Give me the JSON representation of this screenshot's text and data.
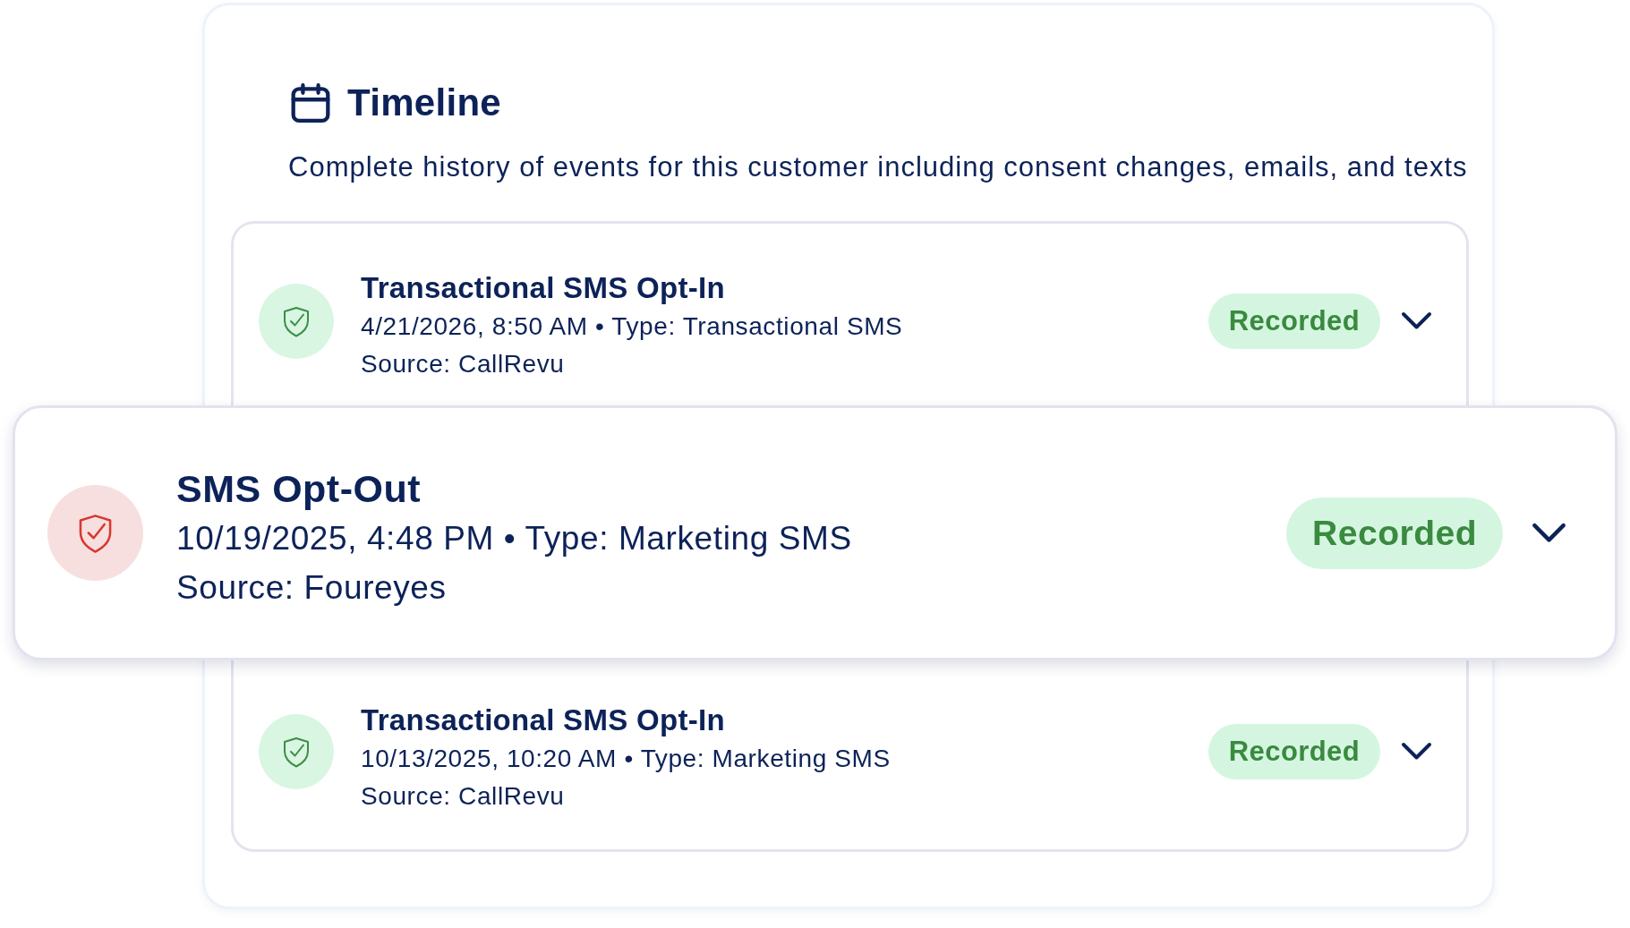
{
  "panel": {
    "title": "Timeline",
    "subtitle": "Complete history of events for this customer including consent changes, emails, and texts"
  },
  "events": [
    {
      "kind": "opt-in",
      "selected": false,
      "title": "Transactional SMS Opt-In",
      "meta": "4/21/2026, 8:50 AM • Type: Transactional SMS",
      "source": "Source: CallRevu",
      "status": "Recorded"
    },
    {
      "kind": "opt-out",
      "selected": true,
      "title": "SMS Opt-Out",
      "meta": "10/19/2025, 4:48 PM • Type: Marketing SMS",
      "source": "Source: Foureyes",
      "status": "Recorded"
    },
    {
      "kind": "opt-in",
      "selected": false,
      "title": "Transactional SMS Opt-In",
      "meta": "10/13/2025, 10:20 AM • Type: Marketing SMS",
      "source": "Source: CallRevu",
      "status": "Recorded"
    }
  ]
}
